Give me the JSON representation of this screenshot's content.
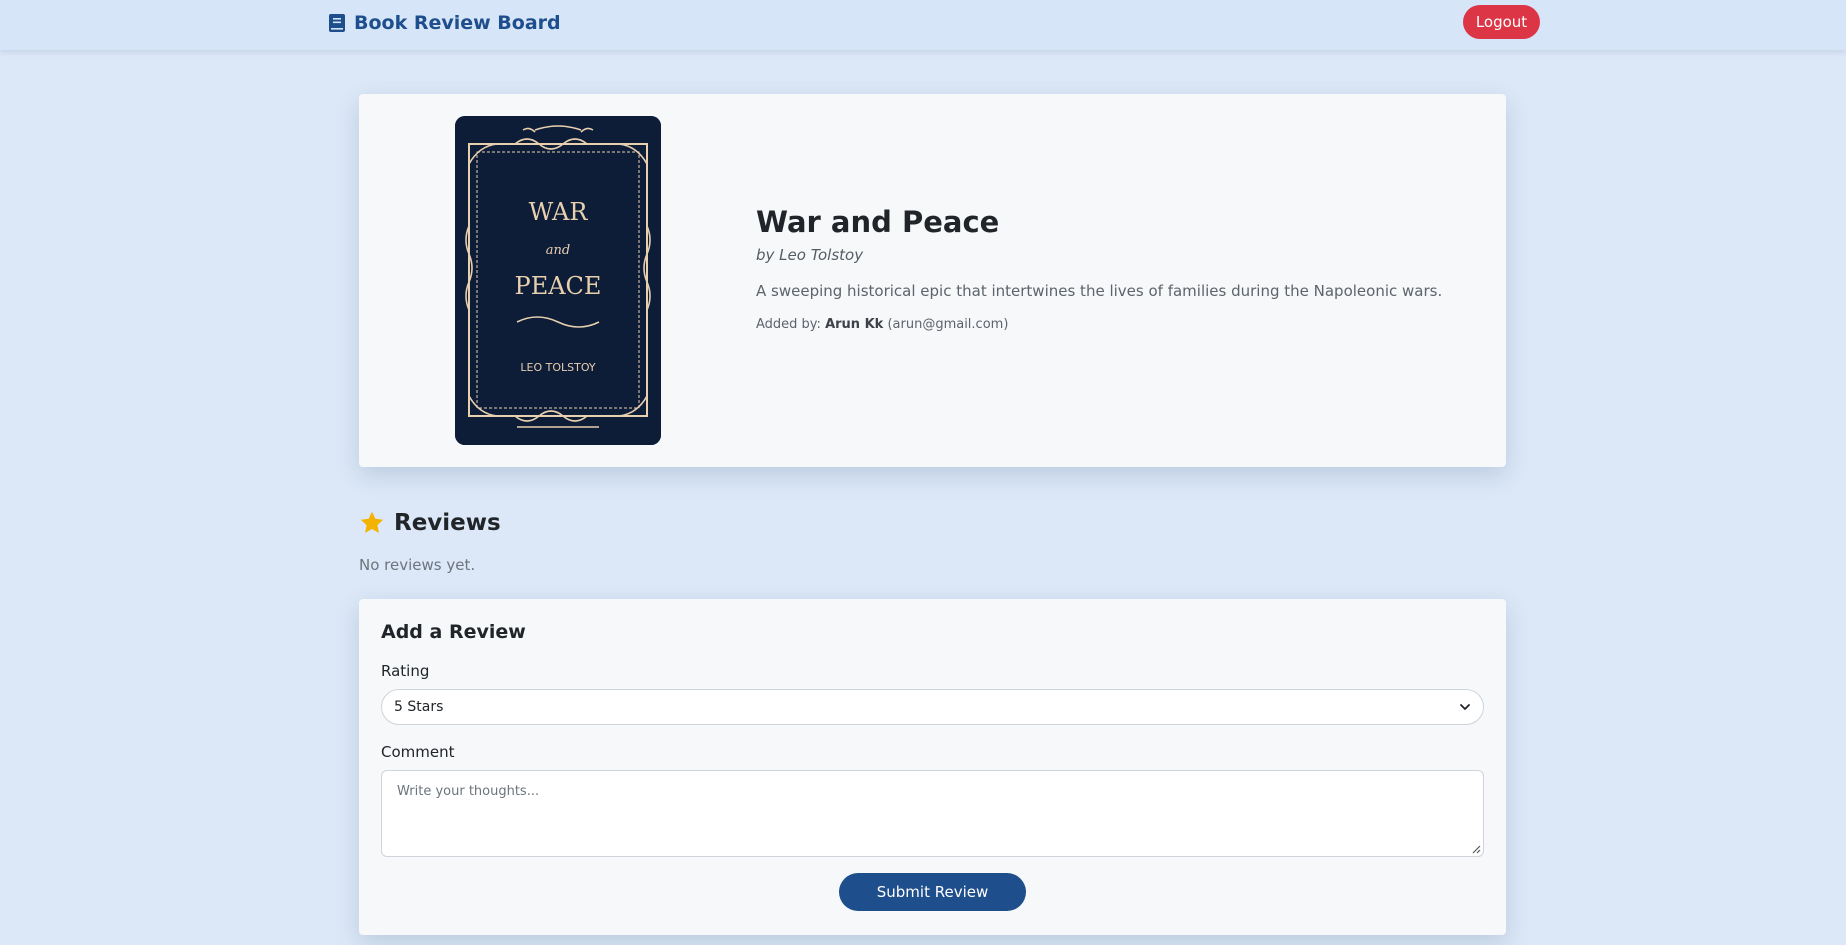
{
  "navbar": {
    "brand": "Book Review Board",
    "brand_icon": "book-icon",
    "logout_label": "Logout"
  },
  "book": {
    "title": "War and Peace",
    "author": "by Leo Tolstoy",
    "description": "A sweeping historical epic that intertwines the lives of families during the Napoleonic wars.",
    "added_by_label": "Added by:",
    "added_by_name": "Arun Kk",
    "added_by_email": "(arun@gmail.com)",
    "cover": {
      "line1": "WAR",
      "line2": "and",
      "line3": "PEACE",
      "author": "LEO TOLSTOY"
    }
  },
  "reviews": {
    "heading": "Reviews",
    "heading_icon": "star-icon",
    "empty_text": "No reviews yet."
  },
  "form": {
    "title": "Add a Review",
    "rating_label": "Rating",
    "rating_value": "5 Stars",
    "comment_label": "Comment",
    "comment_placeholder": "Write your thoughts...",
    "submit_label": "Submit Review"
  },
  "colors": {
    "brand": "#1f4e8c",
    "logout": "#dc3545",
    "star": "#f5b301",
    "cover_bg": "#0d1d38",
    "cover_ornament": "#e8cfae"
  }
}
